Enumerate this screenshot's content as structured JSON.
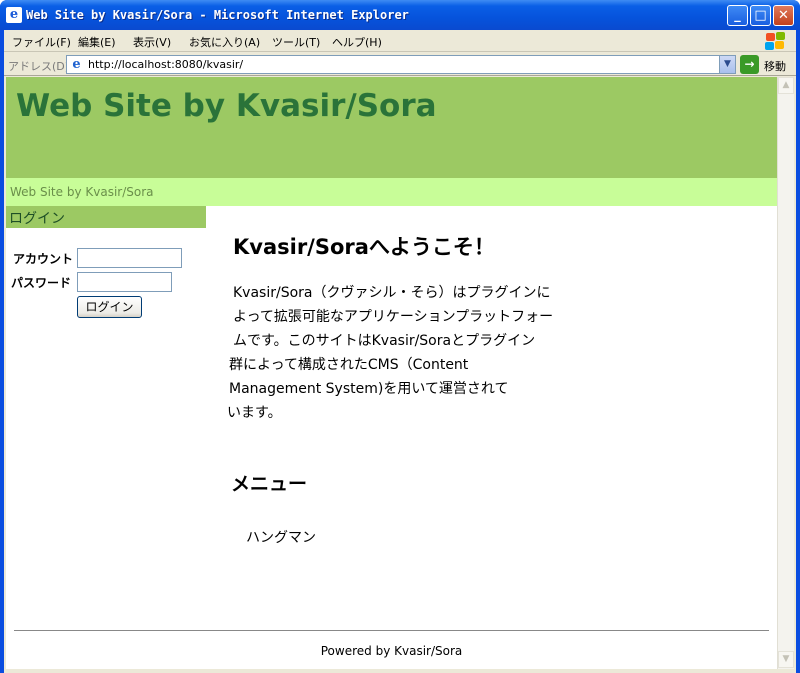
{
  "window": {
    "title": "Web Site by Kvasir/Sora - Microsoft Internet Explorer",
    "minimize_glyph": "_",
    "maximize_glyph": "□",
    "close_glyph": "✕"
  },
  "menubar": {
    "items": [
      {
        "label": "ファイル(F)"
      },
      {
        "label": "編集(E)"
      },
      {
        "label": "表示(V)"
      },
      {
        "label": "お気に入り(A)"
      },
      {
        "label": "ツール(T)"
      },
      {
        "label": "ヘルプ(H)"
      }
    ]
  },
  "address_bar": {
    "label": "アドレス(D)",
    "url": "http://localhost:8080/kvasir/",
    "go_label": "移動"
  },
  "page": {
    "site_title": "Web Site by Kvasir/Sora",
    "breadcrumb": "Web Site by Kvasir/Sora",
    "login": {
      "heading": "ログイン",
      "account_label": "アカウント",
      "password_label": "パスワード",
      "account_value": "",
      "password_value": "",
      "button_label": "ログイン"
    },
    "welcome_heading": "Kvasir/Soraへようこそ！",
    "intro_lines": [
      "Kvasir/Sora（クヴァシル・そら）はプラグインに",
      "よって拡張可能なアプリケーションプラットフォー",
      "ムです。このサイトはKvasir/Soraとプラグイン",
      "群によって構成されたCMS（Content",
      "Management System)を用いて運営されて",
      "います。"
    ],
    "menu_heading": "メニュー",
    "menu_items": [
      "ハングマン"
    ],
    "footer": "Powered by Kvasir/Sora"
  },
  "colors": {
    "header_bg": "#9cc963",
    "subbar_bg": "#c8fd98",
    "title_color": "#2a7339"
  }
}
